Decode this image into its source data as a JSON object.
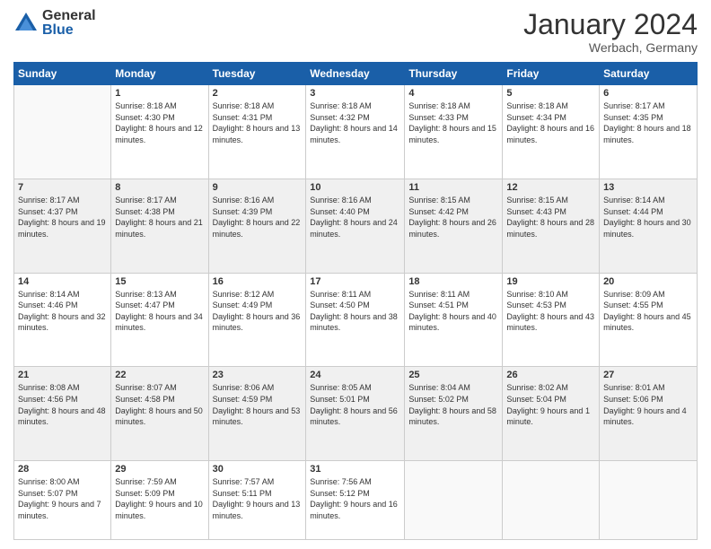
{
  "logo": {
    "general": "General",
    "blue": "Blue"
  },
  "title": "January 2024",
  "location": "Werbach, Germany",
  "weekdays": [
    "Sunday",
    "Monday",
    "Tuesday",
    "Wednesday",
    "Thursday",
    "Friday",
    "Saturday"
  ],
  "weeks": [
    [
      {
        "day": "",
        "sunrise": "",
        "sunset": "",
        "daylight": ""
      },
      {
        "day": "1",
        "sunrise": "Sunrise: 8:18 AM",
        "sunset": "Sunset: 4:30 PM",
        "daylight": "Daylight: 8 hours and 12 minutes."
      },
      {
        "day": "2",
        "sunrise": "Sunrise: 8:18 AM",
        "sunset": "Sunset: 4:31 PM",
        "daylight": "Daylight: 8 hours and 13 minutes."
      },
      {
        "day": "3",
        "sunrise": "Sunrise: 8:18 AM",
        "sunset": "Sunset: 4:32 PM",
        "daylight": "Daylight: 8 hours and 14 minutes."
      },
      {
        "day": "4",
        "sunrise": "Sunrise: 8:18 AM",
        "sunset": "Sunset: 4:33 PM",
        "daylight": "Daylight: 8 hours and 15 minutes."
      },
      {
        "day": "5",
        "sunrise": "Sunrise: 8:18 AM",
        "sunset": "Sunset: 4:34 PM",
        "daylight": "Daylight: 8 hours and 16 minutes."
      },
      {
        "day": "6",
        "sunrise": "Sunrise: 8:17 AM",
        "sunset": "Sunset: 4:35 PM",
        "daylight": "Daylight: 8 hours and 18 minutes."
      }
    ],
    [
      {
        "day": "7",
        "sunrise": "Sunrise: 8:17 AM",
        "sunset": "Sunset: 4:37 PM",
        "daylight": "Daylight: 8 hours and 19 minutes."
      },
      {
        "day": "8",
        "sunrise": "Sunrise: 8:17 AM",
        "sunset": "Sunset: 4:38 PM",
        "daylight": "Daylight: 8 hours and 21 minutes."
      },
      {
        "day": "9",
        "sunrise": "Sunrise: 8:16 AM",
        "sunset": "Sunset: 4:39 PM",
        "daylight": "Daylight: 8 hours and 22 minutes."
      },
      {
        "day": "10",
        "sunrise": "Sunrise: 8:16 AM",
        "sunset": "Sunset: 4:40 PM",
        "daylight": "Daylight: 8 hours and 24 minutes."
      },
      {
        "day": "11",
        "sunrise": "Sunrise: 8:15 AM",
        "sunset": "Sunset: 4:42 PM",
        "daylight": "Daylight: 8 hours and 26 minutes."
      },
      {
        "day": "12",
        "sunrise": "Sunrise: 8:15 AM",
        "sunset": "Sunset: 4:43 PM",
        "daylight": "Daylight: 8 hours and 28 minutes."
      },
      {
        "day": "13",
        "sunrise": "Sunrise: 8:14 AM",
        "sunset": "Sunset: 4:44 PM",
        "daylight": "Daylight: 8 hours and 30 minutes."
      }
    ],
    [
      {
        "day": "14",
        "sunrise": "Sunrise: 8:14 AM",
        "sunset": "Sunset: 4:46 PM",
        "daylight": "Daylight: 8 hours and 32 minutes."
      },
      {
        "day": "15",
        "sunrise": "Sunrise: 8:13 AM",
        "sunset": "Sunset: 4:47 PM",
        "daylight": "Daylight: 8 hours and 34 minutes."
      },
      {
        "day": "16",
        "sunrise": "Sunrise: 8:12 AM",
        "sunset": "Sunset: 4:49 PM",
        "daylight": "Daylight: 8 hours and 36 minutes."
      },
      {
        "day": "17",
        "sunrise": "Sunrise: 8:11 AM",
        "sunset": "Sunset: 4:50 PM",
        "daylight": "Daylight: 8 hours and 38 minutes."
      },
      {
        "day": "18",
        "sunrise": "Sunrise: 8:11 AM",
        "sunset": "Sunset: 4:51 PM",
        "daylight": "Daylight: 8 hours and 40 minutes."
      },
      {
        "day": "19",
        "sunrise": "Sunrise: 8:10 AM",
        "sunset": "Sunset: 4:53 PM",
        "daylight": "Daylight: 8 hours and 43 minutes."
      },
      {
        "day": "20",
        "sunrise": "Sunrise: 8:09 AM",
        "sunset": "Sunset: 4:55 PM",
        "daylight": "Daylight: 8 hours and 45 minutes."
      }
    ],
    [
      {
        "day": "21",
        "sunrise": "Sunrise: 8:08 AM",
        "sunset": "Sunset: 4:56 PM",
        "daylight": "Daylight: 8 hours and 48 minutes."
      },
      {
        "day": "22",
        "sunrise": "Sunrise: 8:07 AM",
        "sunset": "Sunset: 4:58 PM",
        "daylight": "Daylight: 8 hours and 50 minutes."
      },
      {
        "day": "23",
        "sunrise": "Sunrise: 8:06 AM",
        "sunset": "Sunset: 4:59 PM",
        "daylight": "Daylight: 8 hours and 53 minutes."
      },
      {
        "day": "24",
        "sunrise": "Sunrise: 8:05 AM",
        "sunset": "Sunset: 5:01 PM",
        "daylight": "Daylight: 8 hours and 56 minutes."
      },
      {
        "day": "25",
        "sunrise": "Sunrise: 8:04 AM",
        "sunset": "Sunset: 5:02 PM",
        "daylight": "Daylight: 8 hours and 58 minutes."
      },
      {
        "day": "26",
        "sunrise": "Sunrise: 8:02 AM",
        "sunset": "Sunset: 5:04 PM",
        "daylight": "Daylight: 9 hours and 1 minute."
      },
      {
        "day": "27",
        "sunrise": "Sunrise: 8:01 AM",
        "sunset": "Sunset: 5:06 PM",
        "daylight": "Daylight: 9 hours and 4 minutes."
      }
    ],
    [
      {
        "day": "28",
        "sunrise": "Sunrise: 8:00 AM",
        "sunset": "Sunset: 5:07 PM",
        "daylight": "Daylight: 9 hours and 7 minutes."
      },
      {
        "day": "29",
        "sunrise": "Sunrise: 7:59 AM",
        "sunset": "Sunset: 5:09 PM",
        "daylight": "Daylight: 9 hours and 10 minutes."
      },
      {
        "day": "30",
        "sunrise": "Sunrise: 7:57 AM",
        "sunset": "Sunset: 5:11 PM",
        "daylight": "Daylight: 9 hours and 13 minutes."
      },
      {
        "day": "31",
        "sunrise": "Sunrise: 7:56 AM",
        "sunset": "Sunset: 5:12 PM",
        "daylight": "Daylight: 9 hours and 16 minutes."
      },
      {
        "day": "",
        "sunrise": "",
        "sunset": "",
        "daylight": ""
      },
      {
        "day": "",
        "sunrise": "",
        "sunset": "",
        "daylight": ""
      },
      {
        "day": "",
        "sunrise": "",
        "sunset": "",
        "daylight": ""
      }
    ]
  ]
}
